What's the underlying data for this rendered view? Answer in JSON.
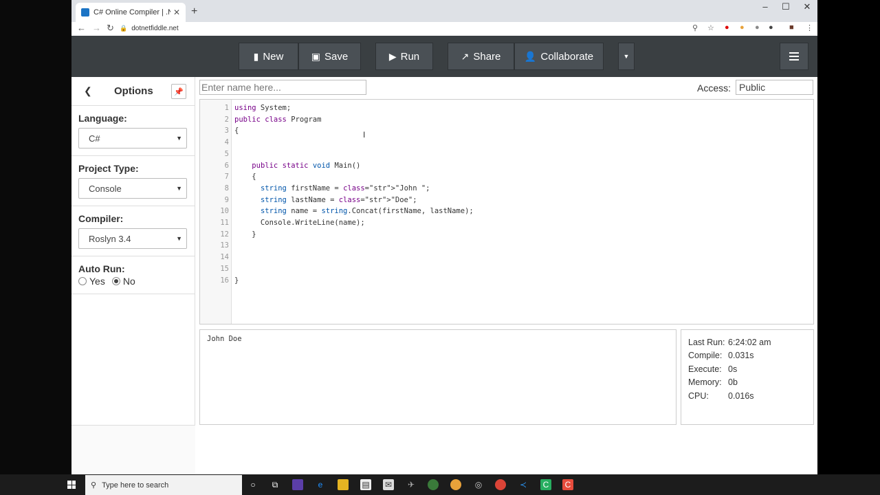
{
  "browser": {
    "tab_title": "C# Online Compiler | .NET Fiddle",
    "tab_close": "✕",
    "new_tab": "+",
    "url": "dotnetfiddle.net",
    "window_controls": [
      "–",
      "☐",
      "✕"
    ]
  },
  "header": {
    "buttons": [
      {
        "label": "New",
        "icon": "file-icon"
      },
      {
        "label": "Save",
        "icon": "floppy-icon"
      },
      {
        "label": "Run",
        "icon": "play-icon"
      },
      {
        "label": "Share",
        "icon": "share-icon"
      },
      {
        "label": "Collaborate",
        "icon": "user-icon"
      }
    ]
  },
  "sidebar": {
    "title": "Options",
    "language_label": "Language:",
    "language_value": "C#",
    "project_type_label": "Project Type:",
    "project_type_value": "Console",
    "compiler_label": "Compiler:",
    "compiler_value": "Roslyn 3.4",
    "auto_run_label": "Auto Run:",
    "auto_run_yes": "Yes",
    "auto_run_no": "No",
    "auto_run_selected": "No"
  },
  "main": {
    "name_placeholder": "Enter name here...",
    "access_label": "Access:",
    "access_value": "Public"
  },
  "editor": {
    "lines": [
      "1",
      "2",
      "3",
      "4",
      "5",
      "6",
      "7",
      "8",
      "9",
      "10",
      "11",
      "12",
      "13",
      "14",
      "15",
      "16"
    ],
    "code": [
      "using System;",
      "public class Program",
      "{",
      "",
      "",
      "    public static void Main()",
      "    {",
      "      string firstName = \"John \";",
      "      string lastName = \"Doe\";",
      "      string name = string.Concat(firstName, lastName);",
      "      Console.WriteLine(name);",
      "    }",
      "",
      "",
      "",
      "}"
    ]
  },
  "output": {
    "text": "John Doe"
  },
  "stats": {
    "last_run_label": "Last Run:",
    "last_run_value": "6:24:02 am",
    "compile_label": "Compile:",
    "compile_value": "0.031s",
    "execute_label": "Execute:",
    "execute_value": "0s",
    "memory_label": "Memory:",
    "memory_value": "0b",
    "cpu_label": "CPU:",
    "cpu_value": "0.016s"
  },
  "taskbar": {
    "search_placeholder": "Type here to search"
  }
}
